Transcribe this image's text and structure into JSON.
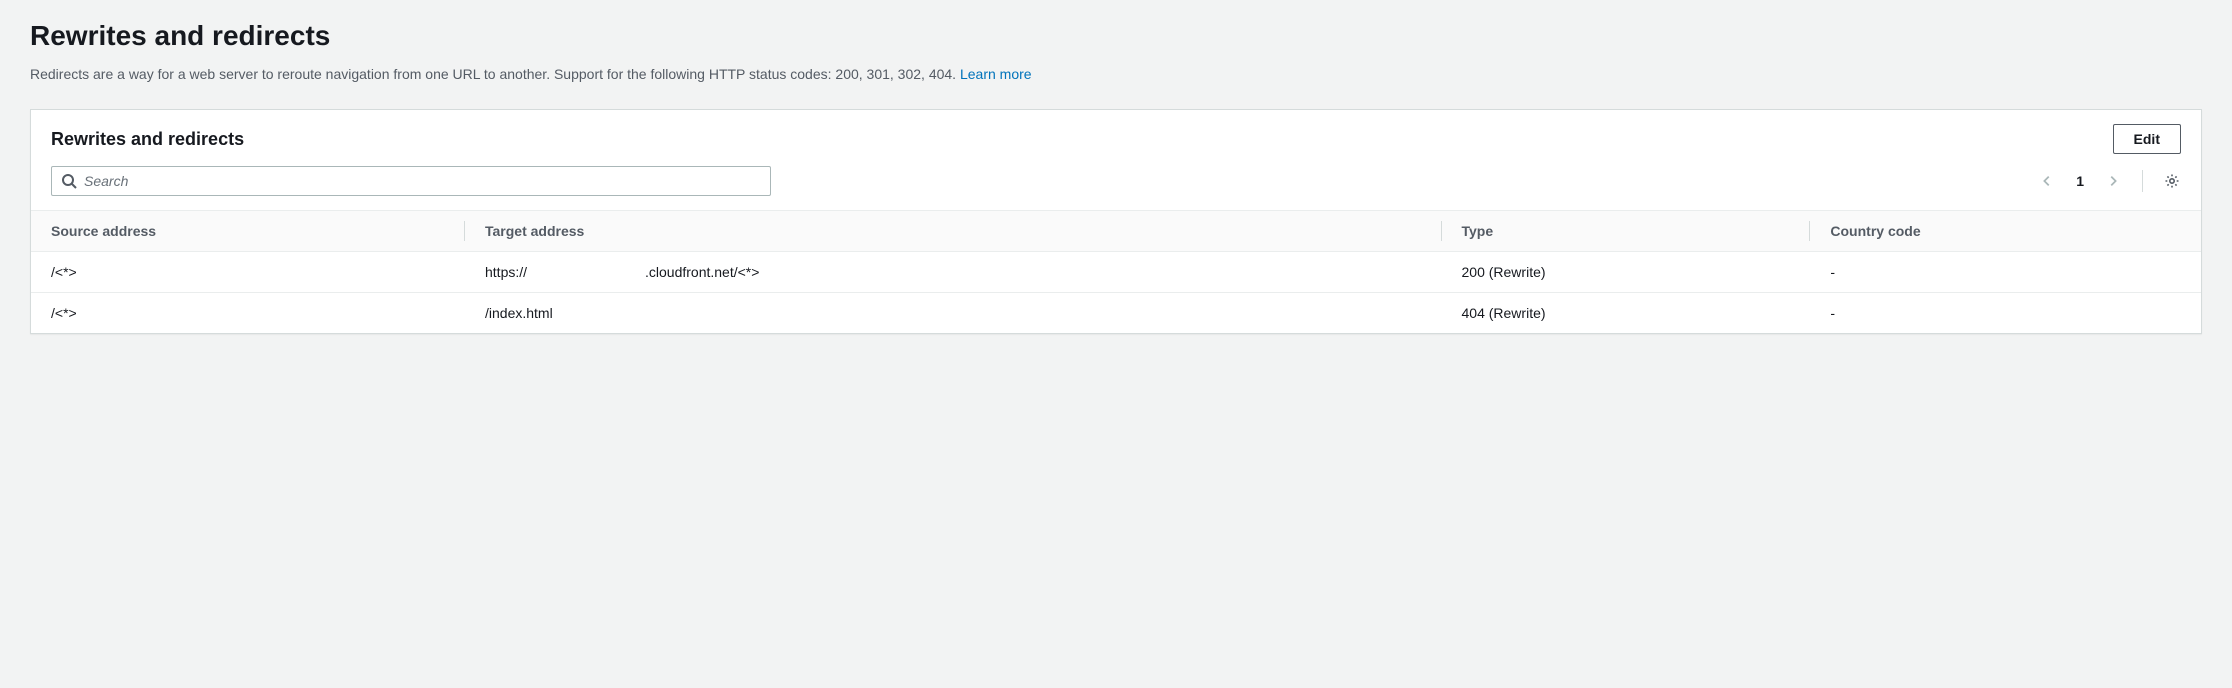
{
  "page": {
    "title": "Rewrites and redirects",
    "description": "Redirects are a way for a web server to reroute navigation from one URL to another. Support for the following HTTP status codes: 200, 301, 302, 404. ",
    "learn_more": "Learn more"
  },
  "panel": {
    "title": "Rewrites and redirects",
    "edit_label": "Edit"
  },
  "search": {
    "placeholder": "Search",
    "value": ""
  },
  "pagination": {
    "current": "1"
  },
  "table": {
    "headers": {
      "source": "Source address",
      "target": "Target address",
      "type": "Type",
      "country": "Country code"
    },
    "rows": [
      {
        "source": "/<*>",
        "target_prefix": "https://",
        "target_suffix": ".cloudfront.net/<*>",
        "type": "200 (Rewrite)",
        "country": "-"
      },
      {
        "source": "/<*>",
        "target_prefix": "/index.html",
        "target_suffix": "",
        "type": "404 (Rewrite)",
        "country": "-"
      }
    ]
  }
}
